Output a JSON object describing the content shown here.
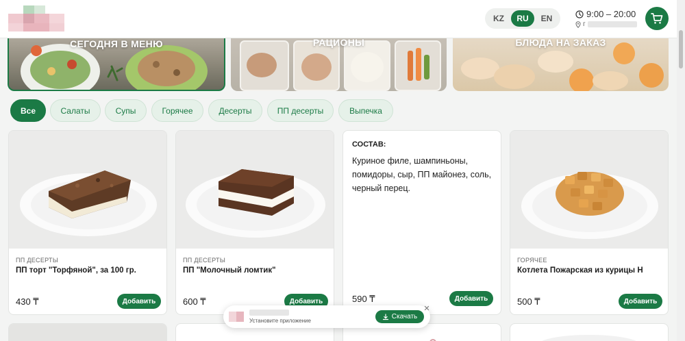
{
  "header": {
    "languages": [
      {
        "code": "KZ",
        "active": false
      },
      {
        "code": "RU",
        "active": true
      },
      {
        "code": "EN",
        "active": false
      }
    ],
    "hours": "9:00 – 20:00",
    "address_prefix": "г",
    "icons": {
      "clock": "clock-icon",
      "location": "location-pin-icon",
      "cart": "cart-icon"
    }
  },
  "banners": [
    {
      "title": "СЕГОДНЯ В МЕНЮ",
      "active": true
    },
    {
      "title": "РАЦИОНЫ",
      "active": false
    },
    {
      "title": "БЛЮДА НА ЗАКАЗ",
      "active": false
    }
  ],
  "filters": [
    {
      "label": "Все",
      "active": true
    },
    {
      "label": "Салаты",
      "active": false
    },
    {
      "label": "Супы",
      "active": false
    },
    {
      "label": "Горячее",
      "active": false
    },
    {
      "label": "Десерты",
      "active": false
    },
    {
      "label": "ПП десерты",
      "active": false
    },
    {
      "label": "Выпечка",
      "active": false
    }
  ],
  "products": [
    {
      "category": "ПП ДЕСЕРТЫ",
      "name": "ПП торт \"Торфяной\", за 100 гр.",
      "price": "430 ₸",
      "add_label": "Добавить"
    },
    {
      "category": "ПП ДЕСЕРТЫ",
      "name": "ПП \"Молочный ломтик\"",
      "price": "600 ₸",
      "add_label": "Добавить"
    },
    {
      "composition_title": "СОСТАВ:",
      "composition": "Куриное филе, шампиньоны, помидоры, сыр, ПП майонез, соль, черный перец.",
      "price": "590 ₸",
      "add_label": "Добавить"
    },
    {
      "category": "ГОРЯЧЕЕ",
      "name": "Котлета Пожарская из курицы Н",
      "price": "500 ₸",
      "add_label": "Добавить"
    }
  ],
  "app_banner": {
    "subtitle": "Установите приложение",
    "download_label": "Скачать",
    "close": "✕"
  },
  "colors": {
    "brand": "#1b7a45",
    "chip_bg": "#e6f1e9",
    "page_bg": "#f3f4f3"
  }
}
